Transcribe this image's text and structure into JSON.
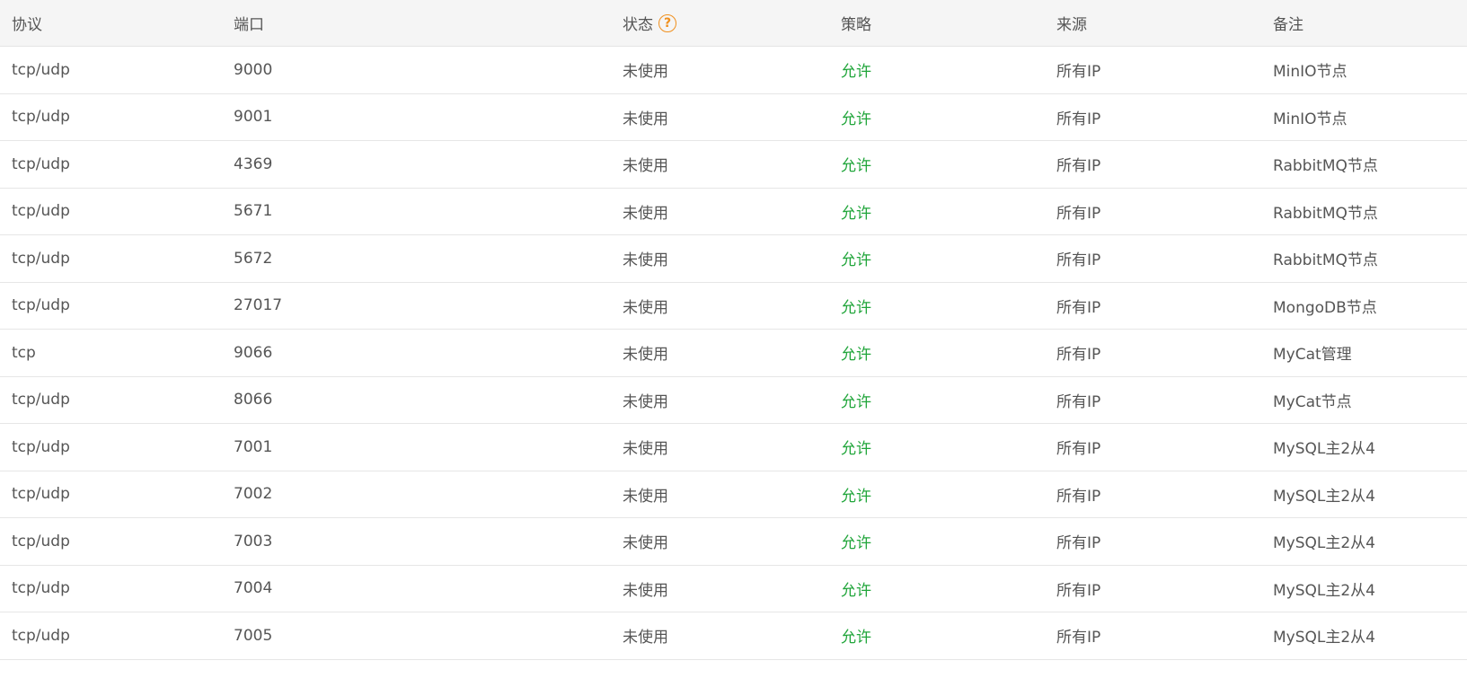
{
  "table": {
    "headers": {
      "protocol": "协议",
      "port": "端口",
      "status": "状态",
      "policy": "策略",
      "source": "来源",
      "remark": "备注"
    },
    "status_help_icon": "question-circle-icon",
    "colors": {
      "allow": "#20a53a",
      "help_icon": "#f0901e",
      "header_bg": "#f5f5f5",
      "text": "#555555"
    },
    "rows": [
      {
        "protocol": "tcp/udp",
        "port": "9000",
        "status": "未使用",
        "policy": "允许",
        "source": "所有IP",
        "remark": "MinIO节点"
      },
      {
        "protocol": "tcp/udp",
        "port": "9001",
        "status": "未使用",
        "policy": "允许",
        "source": "所有IP",
        "remark": "MinIO节点"
      },
      {
        "protocol": "tcp/udp",
        "port": "4369",
        "status": "未使用",
        "policy": "允许",
        "source": "所有IP",
        "remark": "RabbitMQ节点"
      },
      {
        "protocol": "tcp/udp",
        "port": "5671",
        "status": "未使用",
        "policy": "允许",
        "source": "所有IP",
        "remark": "RabbitMQ节点"
      },
      {
        "protocol": "tcp/udp",
        "port": "5672",
        "status": "未使用",
        "policy": "允许",
        "source": "所有IP",
        "remark": "RabbitMQ节点"
      },
      {
        "protocol": "tcp/udp",
        "port": "27017",
        "status": "未使用",
        "policy": "允许",
        "source": "所有IP",
        "remark": "MongoDB节点"
      },
      {
        "protocol": "tcp",
        "port": "9066",
        "status": "未使用",
        "policy": "允许",
        "source": "所有IP",
        "remark": "MyCat管理"
      },
      {
        "protocol": "tcp/udp",
        "port": "8066",
        "status": "未使用",
        "policy": "允许",
        "source": "所有IP",
        "remark": "MyCat节点"
      },
      {
        "protocol": "tcp/udp",
        "port": "7001",
        "status": "未使用",
        "policy": "允许",
        "source": "所有IP",
        "remark": "MySQL主2从4"
      },
      {
        "protocol": "tcp/udp",
        "port": "7002",
        "status": "未使用",
        "policy": "允许",
        "source": "所有IP",
        "remark": "MySQL主2从4"
      },
      {
        "protocol": "tcp/udp",
        "port": "7003",
        "status": "未使用",
        "policy": "允许",
        "source": "所有IP",
        "remark": "MySQL主2从4"
      },
      {
        "protocol": "tcp/udp",
        "port": "7004",
        "status": "未使用",
        "policy": "允许",
        "source": "所有IP",
        "remark": "MySQL主2从4"
      },
      {
        "protocol": "tcp/udp",
        "port": "7005",
        "status": "未使用",
        "policy": "允许",
        "source": "所有IP",
        "remark": "MySQL主2从4"
      }
    ]
  }
}
